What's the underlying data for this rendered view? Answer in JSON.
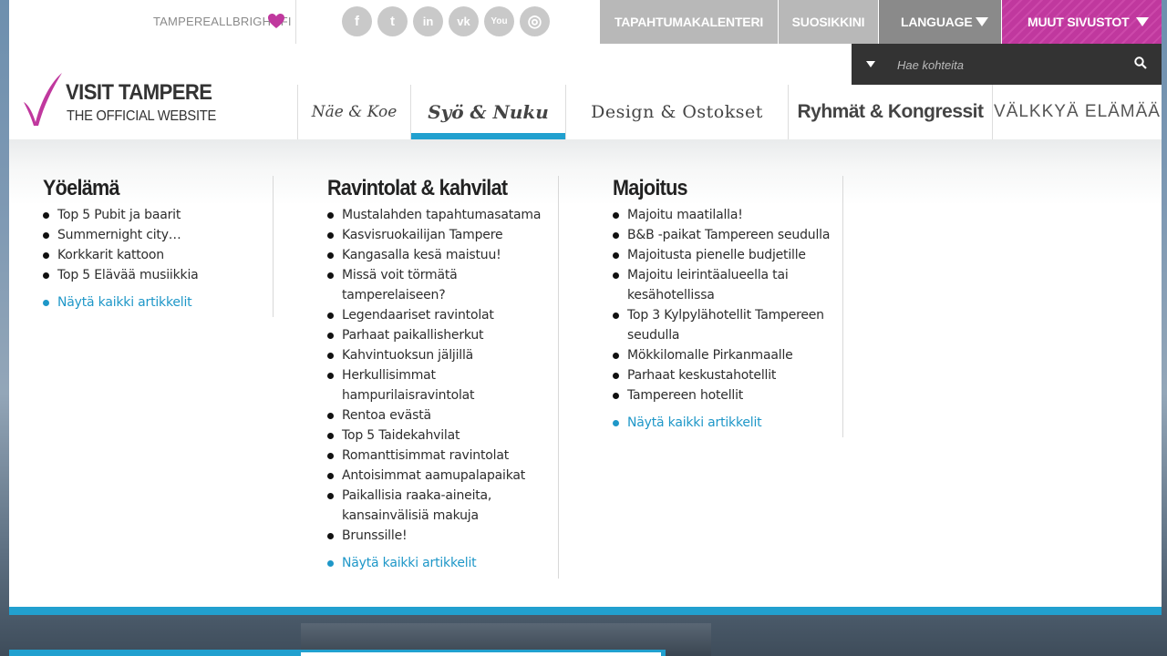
{
  "top": {
    "brand_link": "TAMPEREALLBRIGHT.FI",
    "socials": [
      {
        "icon": "facebook-icon",
        "glyph": "f"
      },
      {
        "icon": "twitter-icon",
        "glyph": "t"
      },
      {
        "icon": "linkedin-icon",
        "glyph": "in"
      },
      {
        "icon": "vk-icon",
        "glyph": "vk"
      },
      {
        "icon": "youtube-icon",
        "glyph": "You"
      },
      {
        "icon": "instagram-icon",
        "glyph": "◎"
      }
    ],
    "nav": {
      "calendar": "TAPAHTUMAKALENTERI",
      "favorites": "SUOSIKKINI",
      "language": "LANGUAGE",
      "other_sites": "MUUT SIVUSTOT"
    }
  },
  "search": {
    "placeholder": "Hae kohteita"
  },
  "logo": {
    "line1": "VISIT TAMPERE",
    "line2": "THE OFFICIAL WEBSITE"
  },
  "mainnav": [
    {
      "label": "Näe & Koe"
    },
    {
      "label": "Syö & Nuku"
    },
    {
      "label": "Design & Ostokset"
    },
    {
      "label": "Ryhmät & Kongressit"
    },
    {
      "label": "VÄLKKYÄ ELÄMÄÄ"
    }
  ],
  "colors": {
    "accent": "#21a0cf",
    "brand_pink": "#c0389e",
    "link": "#1e97c8"
  },
  "columns": {
    "c1": {
      "title": "Yöelämä",
      "items": [
        "Top 5 Pubit ja baarit",
        "Summernight city…",
        "Korkkarit kattoon",
        "Top 5 Elävää musiikkia"
      ],
      "more": "Näytä kaikki artikkelit"
    },
    "c2": {
      "title": "Ravintolat & kahvilat",
      "items": [
        "Mustalahden tapahtumasatama",
        "Kasvisruokailijan Tampere",
        "Kangasalla kesä maistuu!",
        "Missä voit törmätä tamperelaiseen?",
        "Legendaariset ravintolat",
        "Parhaat paikallisherkut",
        "Kahvintuoksun jäljillä",
        "Herkullisimmat hampurilaisravintolat",
        "Rentoa evästä",
        "Top 5 Taidekahvilat",
        "Romanttisimmat ravintolat",
        "Antoisimmat aamupalapaikat",
        "Paikallisia raaka-aineita, kansainvälisiä makuja",
        "Brunssille!"
      ],
      "more": "Näytä kaikki artikkelit"
    },
    "c3": {
      "title": "Majoitus",
      "items": [
        "Majoitu maatilalla!",
        "B&B -paikat Tampereen seudulla",
        "Majoitusta pienelle budjetille",
        "Majoitu leirintäalueella tai kesähotellissa",
        "Top 3 Kylpylähotellit Tampereen seudulla",
        "Mökkilomalle Pirkanmaalle",
        "Parhaat keskustahotellit",
        "Tampereen hotellit"
      ],
      "more": "Näytä kaikki artikkelit"
    }
  }
}
